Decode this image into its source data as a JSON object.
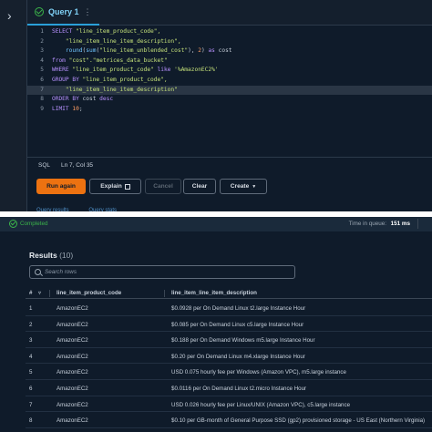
{
  "tab": {
    "label": "Query 1"
  },
  "editor": {
    "lines": [
      {
        "num": "1",
        "segments": [
          [
            "kw",
            "SELECT "
          ],
          [
            "str",
            "\"line_item_product_code\","
          ]
        ]
      },
      {
        "num": "2",
        "segments": [
          [
            "txt",
            "    "
          ],
          [
            "str",
            "\"line_item_line_item_description\","
          ]
        ]
      },
      {
        "num": "3",
        "segments": [
          [
            "txt",
            "    "
          ],
          [
            "fn",
            "round"
          ],
          [
            "txt",
            "("
          ],
          [
            "fn",
            "sum"
          ],
          [
            "txt",
            "("
          ],
          [
            "str",
            "\"line_item_unblended_cost\""
          ],
          [
            "txt",
            "), "
          ],
          [
            "numlit",
            "2"
          ],
          [
            "txt",
            ") "
          ],
          [
            "kw",
            "as"
          ],
          [
            "txt",
            " cost"
          ]
        ]
      },
      {
        "num": "4",
        "segments": [
          [
            "kw",
            "from "
          ],
          [
            "str",
            "\"cost\".\"metrices_data_bucket\""
          ]
        ]
      },
      {
        "num": "5",
        "segments": [
          [
            "kw",
            "WHERE "
          ],
          [
            "str",
            "\"line_item_product_code\""
          ],
          [
            "kw",
            " like "
          ],
          [
            "str",
            "'%AmazonEC2%'"
          ]
        ]
      },
      {
        "num": "6",
        "segments": [
          [
            "kw",
            "GROUP BY "
          ],
          [
            "str",
            "\"line_item_product_code\","
          ]
        ]
      },
      {
        "num": "7",
        "segments": [
          [
            "txt",
            "    "
          ],
          [
            "str",
            "\"line_item_line_item_description\""
          ]
        ]
      },
      {
        "num": "8",
        "segments": [
          [
            "kw",
            "ORDER BY "
          ],
          [
            "txt",
            "cost "
          ],
          [
            "kw",
            "desc"
          ]
        ]
      },
      {
        "num": "9",
        "segments": [
          [
            "kw",
            "LIMIT "
          ],
          [
            "numlit",
            "10"
          ],
          [
            "txt",
            ";"
          ]
        ]
      }
    ],
    "active_line": 7
  },
  "status": {
    "language": "SQL",
    "cursor": "Ln 7, Col 35"
  },
  "buttons": {
    "run": "Run again",
    "explain": "Explain",
    "cancel": "Cancel",
    "clear": "Clear",
    "create": "Create"
  },
  "subtabs": [
    "Query results",
    "Query stats"
  ],
  "completed": {
    "status": "Completed",
    "time_label": "Time in queue:",
    "time_value": "151 ms"
  },
  "results": {
    "title": "Results",
    "count": "(10)"
  },
  "search": {
    "placeholder": "Search rows"
  },
  "table": {
    "columns": [
      "#",
      "line_item_product_code",
      "line_item_line_item_description"
    ],
    "rows": [
      [
        "1",
        "AmazonEC2",
        "$0.0928 per On Demand Linux t2.large Instance Hour"
      ],
      [
        "2",
        "AmazonEC2",
        "$0.085 per On Demand Linux c5.large Instance Hour"
      ],
      [
        "3",
        "AmazonEC2",
        "$0.188 per On Demand Windows m5.large Instance Hour"
      ],
      [
        "4",
        "AmazonEC2",
        "$0.20 per On Demand Linux m4.xlarge Instance Hour"
      ],
      [
        "5",
        "AmazonEC2",
        "USD 0.075 hourly fee per Windows (Amazon VPC), m5.large instance"
      ],
      [
        "6",
        "AmazonEC2",
        "$0.0116 per On Demand Linux t2.micro Instance Hour"
      ],
      [
        "7",
        "AmazonEC2",
        "USD 0.026 hourly fee per Linux/UNIX (Amazon VPC), c5.large instance"
      ],
      [
        "8",
        "AmazonEC2",
        "$0.10 per GB-month of General Purpose SSD (gp2) provisioned storage - US East (Northern Virginia)"
      ]
    ]
  },
  "colors": {
    "accent": "#ec7211",
    "success": "#3bb44a",
    "link": "#7fd0f5"
  }
}
